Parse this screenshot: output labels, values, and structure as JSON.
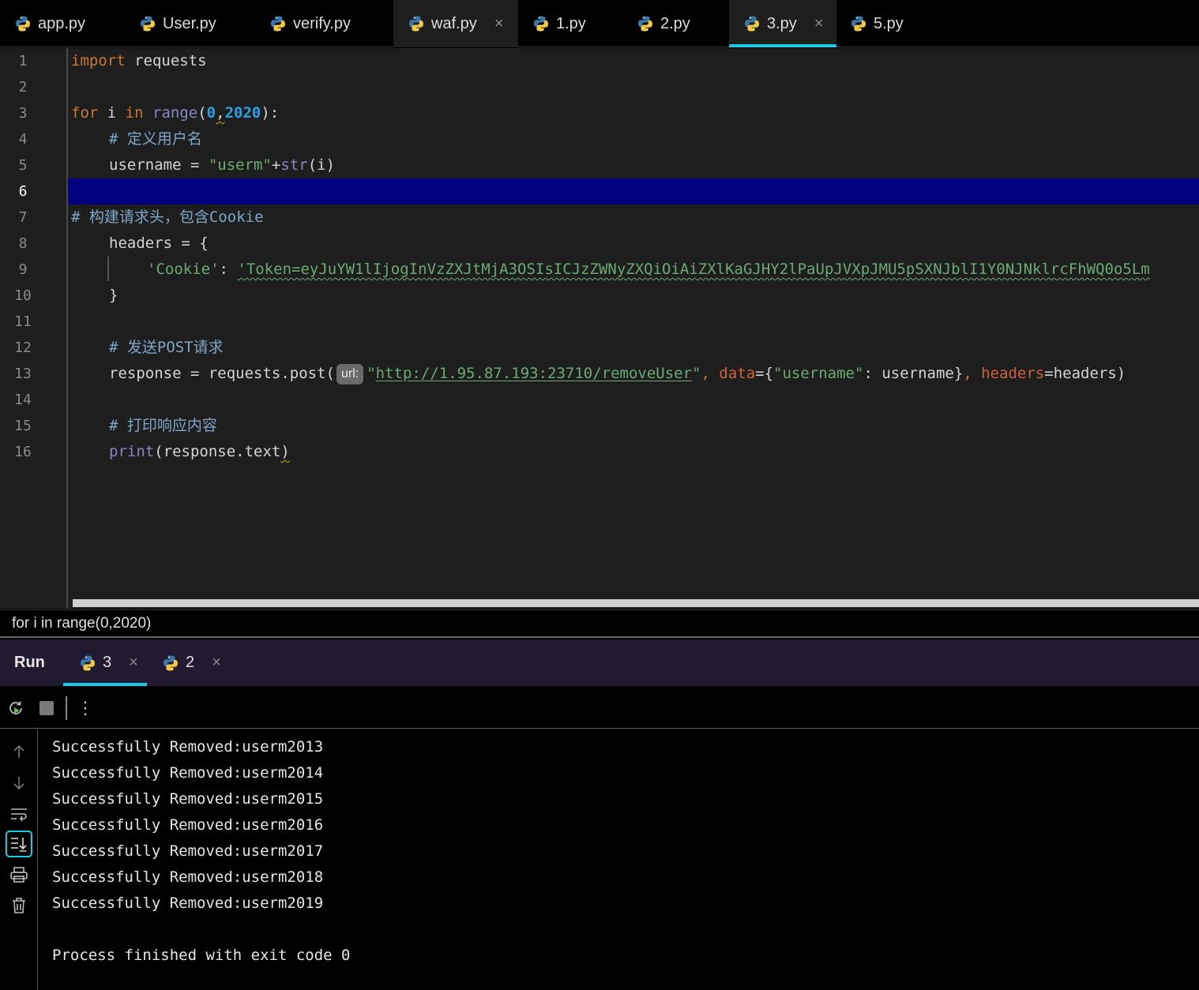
{
  "editor_tabs": [
    {
      "label": "app.py"
    },
    {
      "label": "User.py"
    },
    {
      "label": "verify.py"
    },
    {
      "label": "waf.py",
      "close": "×"
    },
    {
      "label": "1.py"
    },
    {
      "label": "2.py"
    },
    {
      "label": "3.py",
      "close": "×",
      "active": true
    },
    {
      "label": "5.py"
    }
  ],
  "line_numbers": [
    "1",
    "2",
    "3",
    "4",
    "5",
    "6",
    "7",
    "8",
    "9",
    "10",
    "11",
    "12",
    "13",
    "14",
    "15",
    "16"
  ],
  "current_line": "6",
  "code": {
    "l1_kw": "import",
    "l1_rest": " requests",
    "l3_for": "for",
    "l3_i": " i ",
    "l3_in": "in",
    "l3_sp": " ",
    "l3_range": "range",
    "l3_open": "(",
    "l3_zero": "0",
    "l3_comma": ",",
    "l3_end": "2020",
    "l3_close": "):",
    "l4_comment": "# 定义用户名",
    "l5_lhs": "username = ",
    "l5_str": "\"userm\"",
    "l5_plus": "+",
    "l5_str_fn": "str",
    "l5_arg": "(i)",
    "l7_comment": "# 构建请求头，包含Cookie",
    "l8": "headers = {",
    "l9_key": "'Cookie'",
    "l9_colon": ": ",
    "l9_value": "'Token=eyJuYW1lIjogInVzZXJtMjA3OSIsICJzZWNyZXQiOiAiZXlKaGJHY2lPaUpJVXpJMU5pSXNJblI1Y0NJNklrcFhWQ0o5Lm",
    "l10": "}",
    "l12_comment": "# 发送POST请求",
    "l13_lhs": "response = requests.post(",
    "l13_hint": "url:",
    "l13_q1": "\"",
    "l13_url": "http://1.95.87.193:23710/removeUser",
    "l13_q2": "\"",
    "l13_c1": ", ",
    "l13_data": "data",
    "l13_eq1": "={",
    "l13_key": "\"username\"",
    "l13_mid": ": username}",
    "l13_c2": ", ",
    "l13_headers": "headers",
    "l13_tail": "=headers)",
    "l15_comment": "# 打印响应内容",
    "l16_fn": "print",
    "l16_rest": "(response.text",
    "l16_close": ")"
  },
  "breadcrumb": "for i in range(0,2020)",
  "run_panel": {
    "title": "Run",
    "tabs": [
      {
        "label": "3",
        "close": "×"
      },
      {
        "label": "2",
        "close": "×"
      }
    ],
    "toolbar_icons": [
      "rerun-icon",
      "stop-icon",
      "more-icon"
    ],
    "more_glyph": "⋮",
    "side_icons": [
      "arrow-up-icon",
      "arrow-down-icon",
      "soft-wrap-icon",
      "scroll-to-end-icon",
      "print-icon",
      "trash-icon"
    ]
  },
  "console_output": [
    "Successfully Removed:userm2013",
    "Successfully Removed:userm2014",
    "Successfully Removed:userm2015",
    "Successfully Removed:userm2016",
    "Successfully Removed:userm2017",
    "Successfully Removed:userm2018",
    "Successfully Removed:userm2019",
    "",
    "Process finished with exit code 0"
  ],
  "colors": {
    "accent": "#1ec8e8",
    "keyword": "#cc7832",
    "string": "#6aab73",
    "comment": "#7fa6c9",
    "current_line": "#000080"
  }
}
